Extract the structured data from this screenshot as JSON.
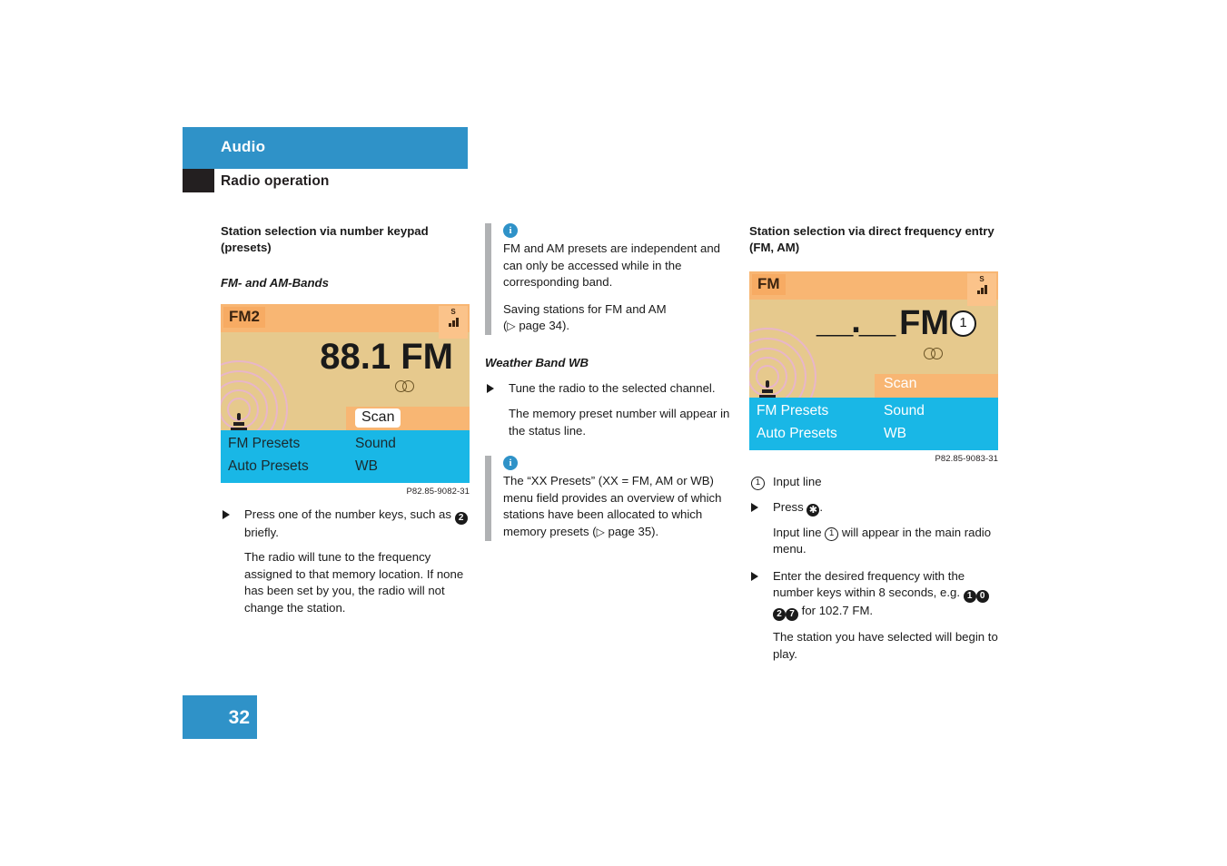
{
  "header": {
    "chapter": "Audio",
    "section": "Radio operation"
  },
  "page_number": "32",
  "col1": {
    "heading": "Station selection via number keypad (presets)",
    "subheading": "FM- and AM-Bands",
    "figure": {
      "band": "FM2",
      "signal_letter": "S",
      "frequency": "88.1 FM",
      "scan_label": "Scan",
      "menu": [
        "FM Presets",
        "Sound",
        "Auto Presets",
        "WB"
      ],
      "caption": "P82.85-9082-31"
    },
    "step1_a": "Press one of the number keys, such as",
    "step1_key": "2",
    "step1_b": "briefly.",
    "para1": "The radio will tune to the frequency assigned to that memory location. If none has been set by you, the radio will not change the station."
  },
  "col2": {
    "info1_icon": "info-icon",
    "info1_p1": "FM and AM presets are independent and can only be accessed while in the corresponding band.",
    "info1_p2_a": "Saving stations for FM and AM",
    "info1_p2_b": "page 34).",
    "subheading": "Weather Band WB",
    "step1": "Tune the radio to the selected channel.",
    "para1": "The memory preset number will appear in the status line.",
    "info2_icon": "info-icon",
    "info2_a": "The “XX Presets” (XX = FM, AM or WB) menu field provides an overview of which stations have been allocated to which memory presets (",
    "info2_b": "page 35)."
  },
  "col3": {
    "heading": "Station selection via direct frequency entry (FM, AM)",
    "figure": {
      "band": "FM",
      "signal_letter": "S",
      "entry_blank": "__.__",
      "entry_unit": "FM",
      "callout": "1",
      "scan_label": "Scan",
      "menu": [
        "FM Presets",
        "Sound",
        "Auto Presets",
        "WB"
      ],
      "caption": "P82.85-9083-31"
    },
    "legend_num": "1",
    "legend_label": "Input line",
    "step1_a": "Press",
    "step1_key": "✱",
    "step1_b": ".",
    "para1_a": "Input line",
    "para1_num": "1",
    "para1_b": "will appear in the main radio menu.",
    "step2": "Enter the desired frequency with the number keys within 8 seconds, e.g.",
    "step2_keys": [
      "1",
      "0",
      "2",
      "7"
    ],
    "step2_tail": "for 102.7 FM.",
    "para2": "The station you have selected will begin to play."
  },
  "colors": {
    "brand_blue": "#2f92c8",
    "display_bg": "#e6c98d",
    "display_bar": "#f8b673",
    "display_menu": "#19b7e6",
    "grey_bar": "#b0b2b4"
  }
}
